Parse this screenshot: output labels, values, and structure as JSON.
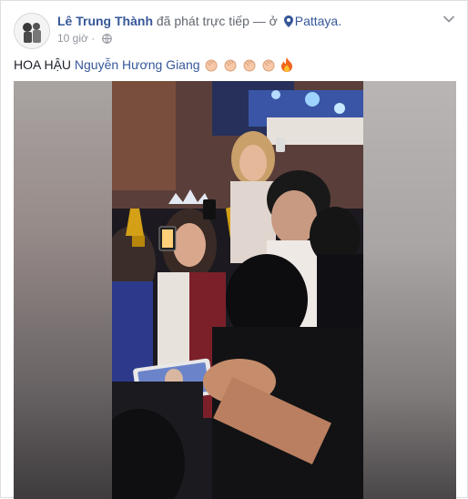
{
  "post": {
    "author": "Lê Trung Thành",
    "action": "đã phát trực tiếp — ở",
    "location": "Pattaya.",
    "time": "10 giờ",
    "message_prefix": "HOA HẬU",
    "tagged_name": "Nguyễn Hương Giang",
    "icons": [
      "map-pin-icon",
      "globe-icon",
      "chevron-down-icon",
      "clapping-hands-emoji",
      "fire-emoji"
    ]
  },
  "colors": {
    "link": "#365899",
    "text": "#1d2129",
    "meta": "#90949c",
    "border": "#dddfe2"
  }
}
